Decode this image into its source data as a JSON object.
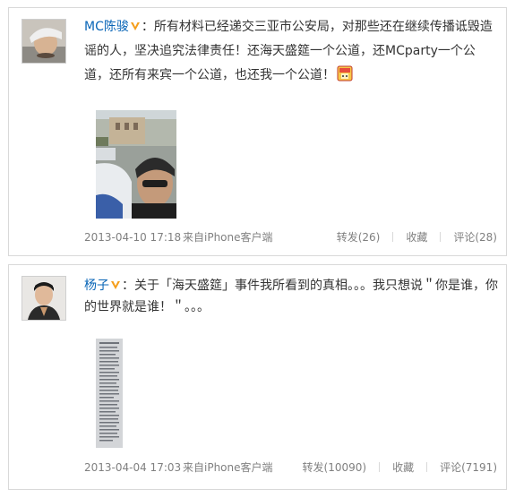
{
  "posts": [
    {
      "user": "MC陈骏",
      "text": "：所有材料已经递交三亚市公安局，对那些还在继续传播诋毁造谣的人，坚决追究法律责任！还海天盛筵一个公道，还MCparty一个公道，还所有来宾一个公道，也还我一个公道！",
      "time": "2013-04-10 17:18",
      "source": "来自iPhone客户端",
      "repost": "转发(26)",
      "favorite": "收藏",
      "comment": "评论(28)",
      "emoji_icon": "lantern-emoji-icon"
    },
    {
      "user": "杨子",
      "text": "：关于「海天盛筵」事件我所看到的真相。。。我只想说＂你是谁，你的世界就是谁！＂。。。",
      "time": "2013-04-04 17:03",
      "source": "来自iPhone客户端",
      "repost": "转发(10090)",
      "favorite": "收藏",
      "comment": "评论(7191)"
    }
  ],
  "colors": {
    "link": "#0a66b7",
    "meta": "#808080",
    "badge": "#f59e1b",
    "border": "#d9d9d9"
  }
}
